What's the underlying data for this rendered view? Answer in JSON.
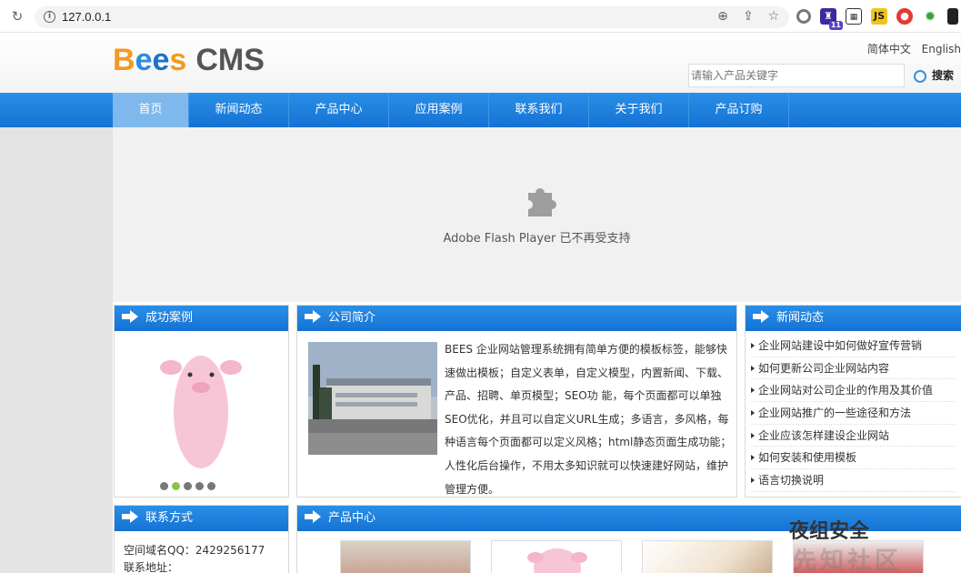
{
  "browser": {
    "url": "127.0.0.1",
    "ext_icons": [
      "circle-extension-icon",
      "purple-extension-icon",
      "qr-extension-icon",
      "js-extension-icon",
      "red-extension-icon",
      "gear-extension-icon",
      "puzzle-extension-icon"
    ]
  },
  "header": {
    "logo_bees": [
      "B",
      "e",
      "e",
      "s"
    ],
    "logo_cms": "CMS",
    "lang_zh": "简体中文",
    "lang_en": "English",
    "search_placeholder": "请输入产品关键字",
    "search_button": "搜索"
  },
  "nav": {
    "items": [
      "首页",
      "新闻动态",
      "产品中心",
      "应用案例",
      "联系我们",
      "关于我们",
      "产品订购"
    ],
    "active_color": "#7eb8ec",
    "bar_color": "#1a7fdd"
  },
  "flash": {
    "message": "Adobe Flash Player 已不再受支持"
  },
  "cases": {
    "title": "成功案例",
    "dot_count": 5,
    "active_dot": 2
  },
  "about": {
    "title": "公司简介",
    "text": "BEES 企业网站管理系统拥有简单方便的模板标签，能够快速做出模板；自定义表单，自定义模型，内置新闻、下载、产品、招聘、单页模型；SEO功 能，每个页面都可以单独SEO优化，并且可以自定义URL生成；多语言，多风格，每种语言每个页面都可以定义风格；html静态页面生成功能；人性化后台操作，不用太多知识就可以快速建好网站，维护管理方便。"
  },
  "news": {
    "title": "新闻动态",
    "items": [
      "企业网站建设中如何做好宣传营销",
      "如何更新公司企业网站内容",
      "企业网站对公司企业的作用及其价值",
      "企业网站推广的一些途径和方法",
      "企业应该怎样建设企业网站",
      "如何安装和使用模板",
      "语言切换说明"
    ]
  },
  "contact": {
    "title": "联系方式",
    "qq": "空间域名QQ：2429256177",
    "address": "联系地址："
  },
  "products": {
    "title": "产品中心"
  },
  "watermark": {
    "text": "夜组安全",
    "sub": "先知社区"
  }
}
